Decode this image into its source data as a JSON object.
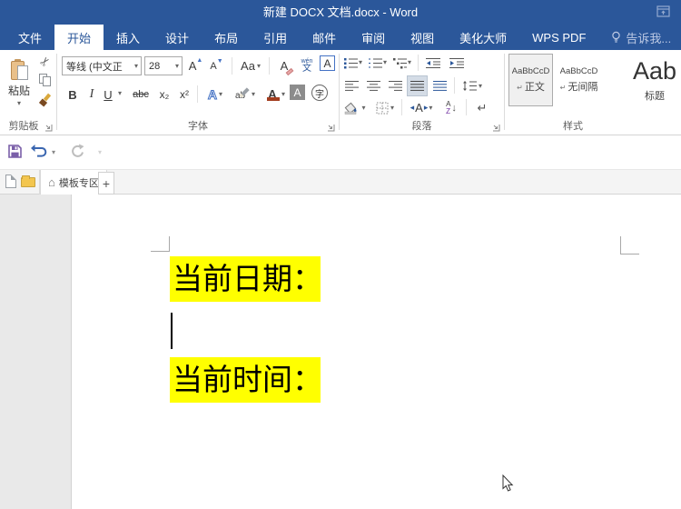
{
  "window": {
    "title": "新建 DOCX 文档.docx - Word"
  },
  "ribbon_tabs": {
    "items": [
      {
        "label": "文件"
      },
      {
        "label": "开始"
      },
      {
        "label": "插入"
      },
      {
        "label": "设计"
      },
      {
        "label": "布局"
      },
      {
        "label": "引用"
      },
      {
        "label": "邮件"
      },
      {
        "label": "审阅"
      },
      {
        "label": "视图"
      },
      {
        "label": "美化大师"
      },
      {
        "label": "WPS PDF"
      },
      {
        "label": "告诉我..."
      }
    ]
  },
  "clipboard": {
    "group_label": "剪贴板",
    "paste_label": "粘贴"
  },
  "font": {
    "group_label": "字体",
    "name": "等线 (中文正",
    "size": "28",
    "grow": "A",
    "shrink": "A",
    "case_toggle": "Aa",
    "clear_format": "A",
    "phonetic_top": "wén",
    "phonetic_bottom": "文",
    "char_border": "A",
    "bold": "B",
    "italic": "I",
    "underline": "U",
    "strikethrough": "abc",
    "subscript": "x₂",
    "superscript": "x²",
    "text_effects": "A",
    "highlight_text": "ab",
    "font_color": "A",
    "char_shading": "A",
    "enclose": "字"
  },
  "paragraph": {
    "group_label": "段落",
    "sort_a": "A",
    "sort_z": "Z",
    "mark": "↵",
    "char_layout": "A"
  },
  "styles": {
    "group_label": "样式",
    "items": [
      {
        "preview": "AaBbCcD",
        "mark": "↵",
        "name": "正文"
      },
      {
        "preview": "AaBbCcD",
        "mark": "↵",
        "name": "无间隔"
      },
      {
        "preview": "Aab",
        "mark": "",
        "name": "标题"
      }
    ]
  },
  "tab_bar": {
    "home_tab_label": "模板专区",
    "new_tab_label": "+"
  },
  "document": {
    "date_label": "当前日期：",
    "time_label": "当前时间：",
    "highlight_color": "#ffff00"
  },
  "icons": {
    "caret": "▾",
    "scissors": "✂",
    "home": "⌂",
    "down_arrow": "↓",
    "left_small": "◂",
    "right_small": "▸"
  },
  "colors": {
    "title_bar": "#2b579a",
    "highlight": "#ffff00",
    "font_color_bar": "#a33e1f"
  }
}
